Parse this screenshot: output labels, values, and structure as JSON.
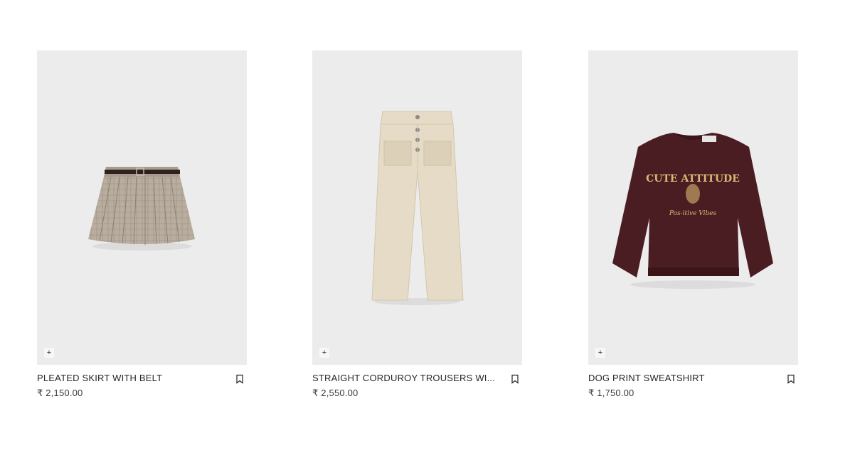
{
  "products": [
    {
      "name": "PLEATED SKIRT WITH BELT",
      "price": "₹ 2,150.00",
      "icon": "bookmark-icon"
    },
    {
      "name": "STRAIGHT CORDUROY TROUSERS WI...",
      "price": "₹ 2,550.00",
      "icon": "bookmark-icon"
    },
    {
      "name": "DOG PRINT SWEATSHIRT",
      "price": "₹ 1,750.00",
      "icon": "bookmark-icon",
      "print_text": {
        "arc": "CUTE ATTITUDE",
        "script": "Pos-itive Vibes"
      }
    }
  ],
  "add_label": "+",
  "colors": {
    "image_bg": "#ececec",
    "skirt": "#b9ad9f",
    "trousers": "#e6dbc6",
    "sweatshirt": "#4a1d22",
    "print": "#d8b877"
  }
}
